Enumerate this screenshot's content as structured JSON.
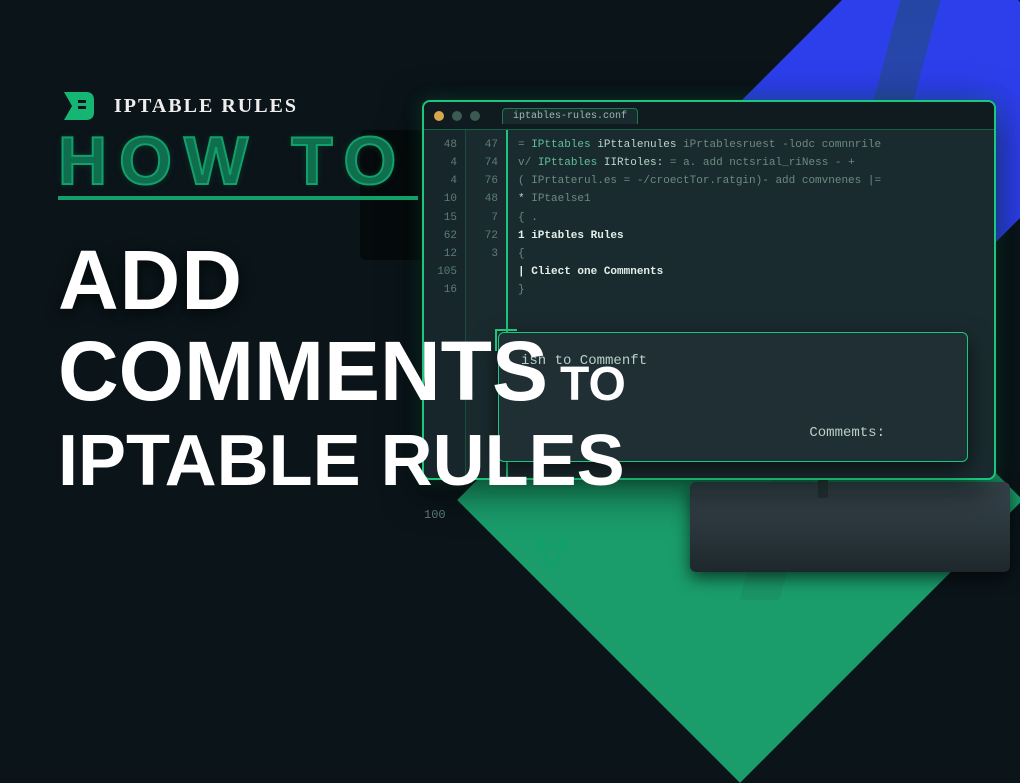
{
  "brand": {
    "name": "IPTABLE RULES"
  },
  "howto": "HOW TO",
  "title": {
    "line1": "ADD",
    "line2a": "COMMENTS",
    "line2b": "TO",
    "line3": "IPTABLE RULES"
  },
  "terminal": {
    "tab_label": "iptables-rules.conf",
    "gutter1": [
      "48",
      "4",
      "4",
      "10",
      "15",
      "62",
      "12",
      "105",
      "16",
      "",
      "",
      " "
    ],
    "gutter2": [
      "",
      "47",
      "",
      "74",
      "76",
      "48",
      "7",
      "",
      "72",
      "3",
      " "
    ],
    "code_lines": [
      {
        "pre": "=",
        "a": "IPttables",
        "b": "iPttalenules",
        "c": "iPrtablesruest",
        "d": "-lodc comnnrile"
      },
      {
        "pre": "v/",
        "a": "IPttables",
        "b": "IIRtoles:",
        "c": "= a. add nctsrial_riNess - +"
      },
      {
        "pre": "",
        "a": "",
        "b": "",
        "c": "( IPrtaterul.es = -/croectTor.ratgin)- add comvnenes |="
      },
      {
        "pre": "",
        "a": "",
        "b": "*",
        "c": "IPtaelse1"
      },
      {
        "pre": "",
        "a": "",
        "b": "",
        "c": "{ ."
      },
      {
        "pre": "",
        "a": "",
        "b": "",
        "c": "1 iPtables Rules"
      },
      {
        "pre": "",
        "a": "",
        "b": "",
        "c": "  {"
      },
      {
        "pre": "",
        "a": "",
        "b": "",
        "c": "| Cliect one Commnents"
      },
      {
        "pre": "",
        "a": "",
        "b": "",
        "c": " }"
      }
    ]
  },
  "tooltip": {
    "line1": "isn  to Commenft",
    "line2": "Commemts:"
  },
  "bottom_number": "100"
}
